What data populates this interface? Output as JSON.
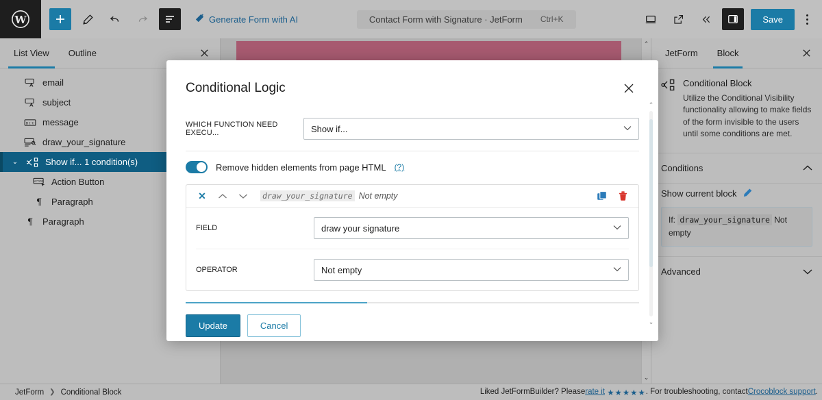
{
  "topbar": {
    "logo_icon": "wordpress-logo-icon",
    "add_label": "+",
    "tools": [
      {
        "name": "add-block-button",
        "icon": "plus-icon"
      },
      {
        "name": "edit-tool-button",
        "icon": "pencil-icon"
      },
      {
        "name": "undo-button",
        "icon": "undo-arrow-icon"
      },
      {
        "name": "redo-button",
        "icon": "redo-arrow-icon"
      },
      {
        "name": "list-view-button",
        "icon": "list-view-icon"
      }
    ],
    "ai_label": "Generate Form with AI",
    "ai_icon": "magic-wand-icon",
    "doc_title": "Contact Form with Signature · JetForm",
    "shortcut": "Ctrl+K",
    "view_icon": "desktop-icon",
    "preview_icon": "external-link-icon",
    "collapse_icon": "double-chevron-left-icon",
    "sidebar_icon": "settings-panel-icon",
    "save_label": "Save",
    "more_icon": "kebab-menu-icon"
  },
  "left_panel": {
    "tabs": [
      {
        "label": "List View",
        "active": true
      },
      {
        "label": "Outline",
        "active": false
      }
    ],
    "close_icon": "close-icon",
    "items": [
      {
        "label": "email",
        "icon": "text-field-icon",
        "indent": 0,
        "selected": false,
        "caret": ""
      },
      {
        "label": "subject",
        "icon": "text-field-icon",
        "indent": 0,
        "selected": false,
        "caret": ""
      },
      {
        "label": "message",
        "icon": "textarea-field-icon",
        "indent": 0,
        "selected": false,
        "caret": ""
      },
      {
        "label": "draw_your_signature",
        "icon": "signature-field-icon",
        "indent": 0,
        "selected": false,
        "caret": ""
      },
      {
        "label": "Show if... 1 condition(s)",
        "icon": "conditional-block-icon",
        "indent": 0,
        "selected": true,
        "caret": "⌄"
      },
      {
        "label": "Action Button",
        "icon": "action-button-icon",
        "indent": 1,
        "selected": false,
        "caret": ""
      },
      {
        "label": "Paragraph",
        "icon": "paragraph-icon",
        "indent": 1,
        "selected": false,
        "caret": ""
      },
      {
        "label": "Paragraph",
        "icon": "paragraph-icon",
        "indent": 0,
        "selected": false,
        "caret": ""
      }
    ]
  },
  "right_panel": {
    "tabs": [
      {
        "label": "JetForm",
        "active": false
      },
      {
        "label": "Block",
        "active": true
      }
    ],
    "close_icon": "close-icon",
    "block_icon": "conditional-block-icon",
    "block_title": "Conditional Block",
    "block_desc": "Utilize the Conditional Visibility functionality allowing to make fields of the form invisible to the users until some conditions are met.",
    "conditions_section": "Conditions",
    "conditions_chevron": "chevron-up-icon",
    "condition_item_label": "Show current block",
    "edit_icon": "pencil-edit-icon",
    "condition_prefix": "If:",
    "condition_field": "draw_your_signature",
    "condition_operator": "Not empty",
    "advanced_section": "Advanced",
    "advanced_chevron": "chevron-down-icon"
  },
  "modal": {
    "title": "Conditional Logic",
    "close_icon": "close-icon",
    "function_label": "WHICH FUNCTION NEED EXECU...",
    "function_value": "Show if...",
    "toggle_label": "Remove hidden elements from page HTML",
    "toggle_help": "(?)",
    "toggle_on": true,
    "condition": {
      "remove_icon": "close-x-icon",
      "move_up_icon": "chevron-up-icon",
      "move_down_icon": "chevron-down-icon",
      "summary_field": "draw_your_signature",
      "summary_operator": "Not empty",
      "copy_icon": "duplicate-icon",
      "delete_icon": "trash-icon",
      "field_label": "FIELD",
      "field_value": "draw your signature",
      "operator_label": "OPERATOR",
      "operator_value": "Not empty"
    },
    "update_label": "Update",
    "cancel_label": "Cancel",
    "scroll_up_icon": "chevron-up-icon",
    "scroll_down_icon": "chevron-down-icon"
  },
  "bottombar": {
    "breadcrumb": [
      "JetForm",
      "Conditional Block"
    ],
    "breadcrumb_sep": "❯",
    "notice_pre": "Liked JetFormBuilder? Please ",
    "rate_link": "rate it",
    "stars": "★★★★★",
    "notice_mid": ". For troubleshooting, contact ",
    "support_link": "Crocoblock support",
    "notice_end": "."
  },
  "colors": {
    "accent": "#1b7ba6",
    "selected_row": "#0f5d82",
    "chrome": "#bdbdbd",
    "block_pink": "#a75a70",
    "danger": "#d9352c"
  }
}
